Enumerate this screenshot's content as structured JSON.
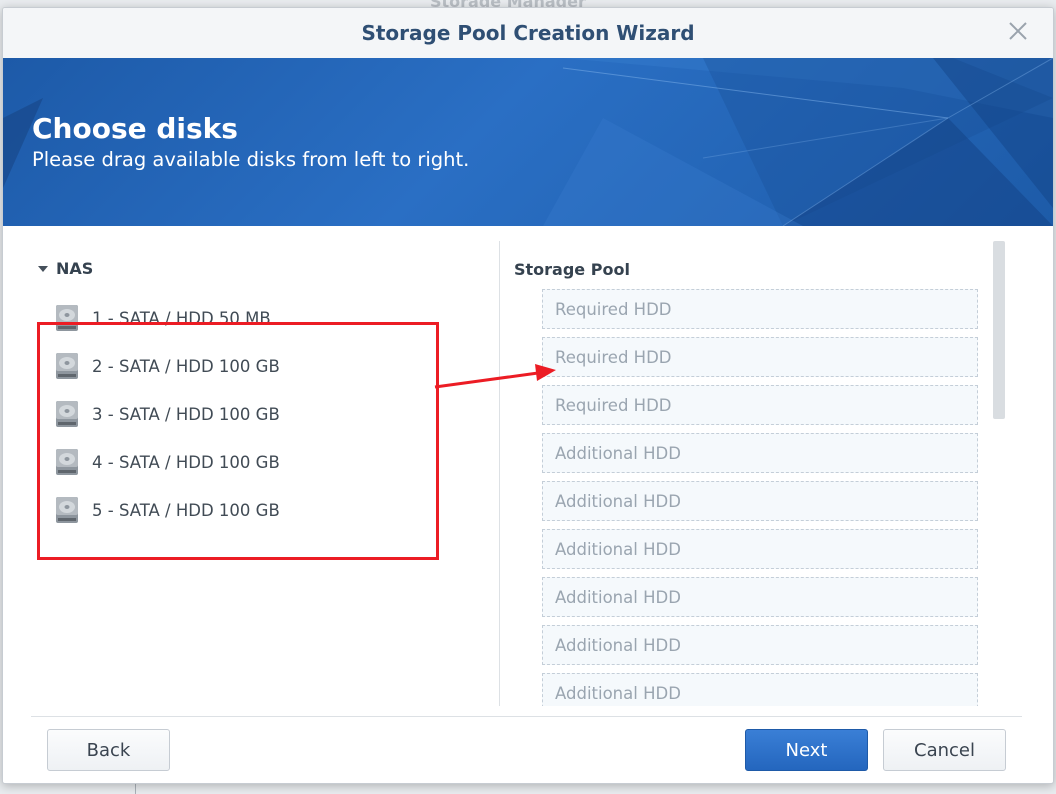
{
  "window": {
    "title": "Storage Pool Creation Wizard",
    "close_icon": "close-icon",
    "background_peek_title": "Storage Manager"
  },
  "banner": {
    "heading": "Choose disks",
    "subheading": "Please drag available disks from left to right."
  },
  "left_pane": {
    "group_label": "NAS",
    "group_icon": "caret-down-icon",
    "disk_icon": "hdd-icon",
    "disks": [
      {
        "label": "1 - SATA / HDD 50 MB"
      },
      {
        "label": "2 - SATA / HDD 100 GB"
      },
      {
        "label": "3 - SATA / HDD 100 GB"
      },
      {
        "label": "4 - SATA / HDD 100 GB"
      },
      {
        "label": "5 - SATA / HDD 100 GB"
      }
    ]
  },
  "right_pane": {
    "title": "Storage Pool",
    "slots": [
      {
        "label": "Required HDD"
      },
      {
        "label": "Required HDD"
      },
      {
        "label": "Required HDD"
      },
      {
        "label": "Additional HDD"
      },
      {
        "label": "Additional HDD"
      },
      {
        "label": "Additional HDD"
      },
      {
        "label": "Additional HDD"
      },
      {
        "label": "Additional HDD"
      },
      {
        "label": "Additional HDD"
      }
    ]
  },
  "footer": {
    "back_label": "Back",
    "next_label": "Next",
    "cancel_label": "Cancel"
  },
  "colors": {
    "banner": "#2a6fc4",
    "primary_button": "#2466be",
    "annotation": "#ec1c24"
  }
}
